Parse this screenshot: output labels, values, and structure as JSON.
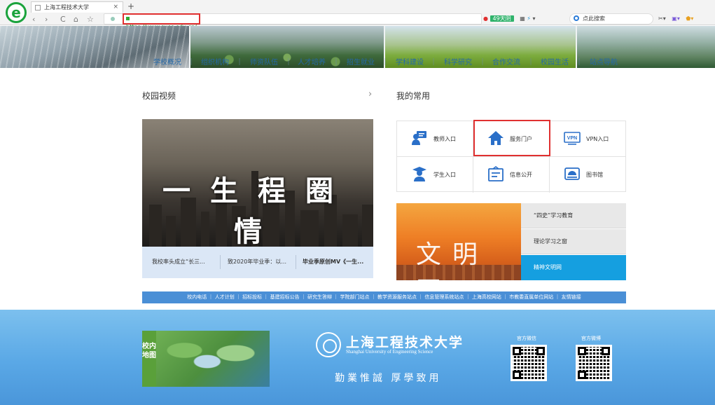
{
  "browser": {
    "tab_title": "上海工程技术大学",
    "new_tab": "+",
    "url": "https://www.sues.edu.cn/",
    "weather_badge": "49天阴",
    "search_placeholder": "点此搜索",
    "nav": {
      "back": "‹",
      "forward": "›",
      "reload": "C",
      "home": "⌂",
      "star": "☆"
    }
  },
  "top_menu": [
    "学校概况",
    "组织机构",
    "师资队伍",
    "人才培养",
    "招生就业",
    "学科建设",
    "科学研究",
    "合作交流",
    "校园生活",
    "站点导航"
  ],
  "video_section": {
    "title": "校园视频",
    "more": "›",
    "overlay_text": "一生程圈情",
    "captions": [
      "我校率头成立“长三...",
      "致2020年毕业季：以...",
      "毕业季原创MV《一生..."
    ]
  },
  "common_section": {
    "title": "我的常用",
    "items": [
      {
        "label": "教师入口",
        "icon": "teacher-icon"
      },
      {
        "label": "服务门户",
        "icon": "home-icon"
      },
      {
        "label": "VPN入口",
        "icon": "vpn-icon",
        "badge": "VPN"
      },
      {
        "label": "学生入口",
        "icon": "student-icon"
      },
      {
        "label": "信息公开",
        "icon": "info-icon"
      },
      {
        "label": "图书馆",
        "icon": "library-icon"
      }
    ]
  },
  "civilization": {
    "banner_text": "文明网",
    "links": [
      "“四史”学习教育",
      "理论学习之窗",
      "精神文明网"
    ]
  },
  "footer_links": "校内电话 ｜ 人才计划 ｜ 招标投标 ｜ 基建招标公告 ｜ 研究生答辩 ｜ 学院部门站点 ｜ 教学资源服务站点 ｜ 信息管理系统站点 ｜ 上海高校网站 ｜ 市教委直属单位网站 ｜ 友情链接",
  "footer": {
    "map_label": "校内地图",
    "university_name": "上海工程技术大学",
    "university_name_en": "Shanghai University of Engineering Science",
    "motto": "勤業惟誠 厚學致用",
    "wechat_label": "官方微信",
    "weibo_label": "官方微博"
  },
  "colors": {
    "accent": "#159fe0",
    "highlight": "#e03030",
    "footer": "#5aa8e6"
  }
}
